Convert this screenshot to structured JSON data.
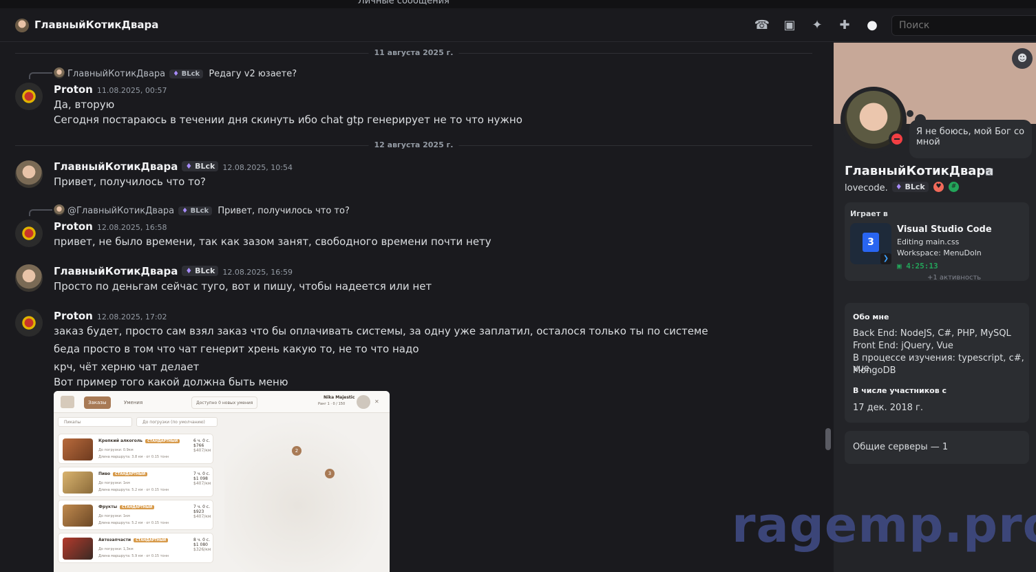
{
  "window": {
    "top_label": "Личные сообщения"
  },
  "header": {
    "title": "ГлавныйКотикДвара",
    "icons": [
      "phone-icon",
      "video-icon",
      "pin-icon",
      "add-friend-icon",
      "profile-toggle-icon"
    ],
    "search_placeholder": "Поиск"
  },
  "chat": {
    "dividers": [
      "11 августа 2025 г.",
      "12 августа 2025 г."
    ],
    "messages": [
      {
        "reply_author": "ГлавныйКотикДвара",
        "reply_tag": "BLck",
        "reply_text": "Редагу v2 юзаете?",
        "author": "Proton",
        "time": "11.08.2025, 00:57",
        "lines": [
          "Да, вторую",
          "Сегодня постараюсь в течении дня скинуть ибо chat gtp генерирует не то что нужно"
        ]
      },
      {
        "author": "ГлавныйКотикДвара",
        "tag": "BLck",
        "time": "12.08.2025, 10:54",
        "lines": [
          "Привет, получилось что то?"
        ]
      },
      {
        "reply_author": "@ГлавныйКотикДвара",
        "reply_tag": "BLck",
        "reply_text": "Привет, получилось что то?",
        "author": "Proton",
        "time": "12.08.2025, 16:58",
        "lines": [
          "привет,  не было времени, так как зазом занят, свободного времени почти  нету"
        ]
      },
      {
        "author": "ГлавныйКотикДвара",
        "tag": "BLck",
        "time": "12.08.2025, 16:59",
        "lines": [
          "Просто по деньгам сейчас туго, вот и пишу, чтобы надеется или нет"
        ]
      },
      {
        "author": "Proton",
        "time": "12.08.2025, 17:02",
        "lines": [
          "заказ будет, просто сам взял заказ что бы оплачивать системы, за одну уже заплатил, осталося только ты по системе",
          "беда просто в том что чат генерит хрень какую то, не то что надо",
          "крч, чёт херню чат делает",
          "Вот пример того какой должна быть меню"
        ]
      }
    ],
    "attachment": {
      "tabs": [
        "Заказы",
        "Умения"
      ],
      "filter_available": "Доступно 0 новых умения",
      "player_name": "Nika Majestic",
      "player_rank": "Ранг 1",
      "player_xp": "0 / 150",
      "selects": [
        "Пикапы",
        "До погрузки (по умолчанию)"
      ],
      "cards": [
        {
          "title": "Крепкий алкоголь",
          "badge": "СТАНДАРТНЫЙ",
          "load": "До погрузки: 0.9км",
          "route": "Длина маршрута: 3.8 км",
          "weight": "от 0.15 тонн",
          "time": "6 ч. 0 с.",
          "price": "$766",
          "price2": "$407/км"
        },
        {
          "title": "Пиво",
          "badge": "СТАНДАРТНЫЙ",
          "load": "До погрузки: 1км",
          "route": "Длина маршрута: 5.2 км",
          "weight": "от 0.15 тонн",
          "time": "7 ч. 0 с.",
          "price": "$1 098",
          "price2": "$407/км"
        },
        {
          "title": "Фрукты",
          "badge": "СТАНДАРТНЫЙ",
          "load": "До погрузки: 1км",
          "route": "Длина маршрута: 5.2 км",
          "weight": "от 0.15 тонн",
          "time": "7 ч. 0 с.",
          "price": "$923",
          "price2": "$407/км"
        },
        {
          "title": "Автозапчасти",
          "badge": "СТАНДАРТНЫЙ",
          "load": "До погрузки: 1,3км",
          "route": "Длина маршрута: 5.9 км",
          "weight": "от 0.15 тонн",
          "time": "8 ч. 0 с.",
          "price": "$1 080",
          "price2": "$326/км"
        }
      ],
      "map_pins": [
        "2",
        "3"
      ]
    }
  },
  "watermark": "ragemp.pro",
  "profile": {
    "custom_status": "Я не боюсь, мой Бог со мной",
    "display_name": "ГлавныйКотикДвара",
    "username": "lovecode.",
    "tag": "BLck",
    "activity": {
      "heading": "Играет в",
      "app": "Visual Studio Code",
      "details": "Editing main.css",
      "state": "Workspace: MenuDoln",
      "elapsed": "4:25:13",
      "more": "+1 активность"
    },
    "about": {
      "heading": "Обо мне",
      "lines": [
        "Back End: NodeJS, C#, PHP, MySQL",
        "Front End: jQuery, Vue",
        "В процессе изучения: typescript, c#, vue,",
        "MongoDB"
      ]
    },
    "member_since": {
      "heading": "В числе участников с",
      "date": "17 дек. 2018 г."
    },
    "mutual_servers": "Общие серверы — 1"
  },
  "colors": {
    "accent": "#5865f2",
    "status_dnd": "#f23f43",
    "online_timer": "#23a55a",
    "banner": "#c7a898"
  }
}
